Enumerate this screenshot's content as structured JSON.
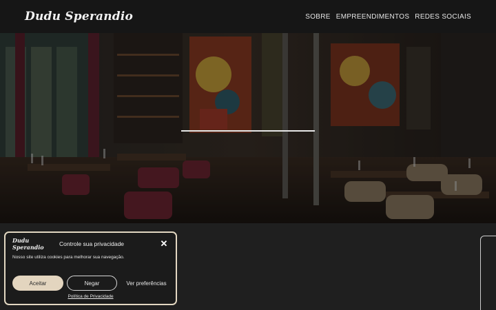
{
  "header": {
    "logo": "Dudu Sperandio",
    "nav": [
      "SOBRE",
      "EMPREENDIMENTOS",
      "REDES SOCIAIS"
    ]
  },
  "cookie_banner": {
    "logo": "Dudu Sperandio",
    "title": "Controle sua privacidade",
    "close_icon": "close-icon",
    "message": "Nosso site utiliza cookies para melhorar sua navegação.",
    "accept_label": "Aceitar",
    "deny_label": "Negar",
    "preferences_label": "Ver preferências",
    "policy_link": "Política de Privacidade"
  },
  "colors": {
    "header_bg": "#161616",
    "page_bg": "#1f1f1f",
    "accent": "#e3d5bf"
  }
}
